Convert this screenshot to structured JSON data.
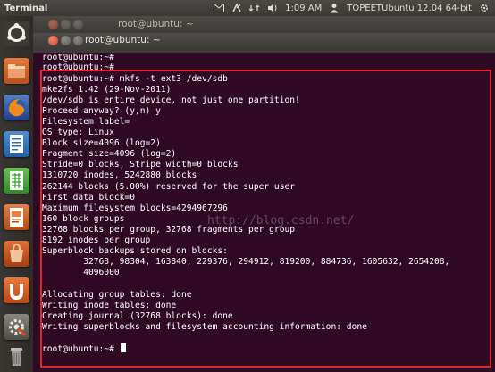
{
  "panel": {
    "app_name": "Terminal",
    "clock": "1:09 AM",
    "user": "TOPEETUbuntu 12.04 64-bit",
    "tray_icons": [
      "mail-icon",
      "keyboard-icon",
      "network-icon",
      "volume-icon",
      "user-icon"
    ]
  },
  "launcher": {
    "items": [
      {
        "name": "ubuntu-dash-icon",
        "color": "#e0560e"
      },
      {
        "name": "home-folder-icon",
        "color": "#d46a2a"
      },
      {
        "name": "firefox-icon",
        "color": "#e8821c"
      },
      {
        "name": "libreoffice-writer-icon",
        "color": "#2c6fb4"
      },
      {
        "name": "libreoffice-calc-icon",
        "color": "#3b9a2e"
      },
      {
        "name": "libreoffice-impress-icon",
        "color": "#c0521e"
      },
      {
        "name": "software-center-icon",
        "color": "#c24a1a"
      },
      {
        "name": "ubuntu-one-icon",
        "color": "#d2571d"
      },
      {
        "name": "system-settings-icon",
        "color": "#6a6660"
      },
      {
        "name": "trash-icon",
        "color": "#7c7a75"
      }
    ]
  },
  "background_window": {
    "title": "root@ubuntu: ~"
  },
  "terminal": {
    "title": "root@ubuntu: ~",
    "lines": [
      "root@ubuntu:~#",
      "root@ubuntu:~#",
      "root@ubuntu:~# mkfs -t ext3 /dev/sdb",
      "mke2fs 1.42 (29-Nov-2011)",
      "/dev/sdb is entire device, not just one partition!",
      "Proceed anyway? (y,n) y",
      "Filesystem label=",
      "OS type: Linux",
      "Block size=4096 (log=2)",
      "Fragment size=4096 (log=2)",
      "Stride=0 blocks, Stripe width=0 blocks",
      "1310720 inodes, 5242880 blocks",
      "262144 blocks (5.00%) reserved for the super user",
      "First data block=0",
      "Maximum filesystem blocks=4294967296",
      "160 block groups",
      "32768 blocks per group, 32768 fragments per group",
      "8192 inodes per group",
      "Superblock backups stored on blocks:",
      "        32768, 98304, 163840, 229376, 294912, 819200, 884736, 1605632, 2654208,",
      "        4096000",
      "",
      "Allocating group tables: done",
      "Writing inode tables: done",
      "Creating journal (32768 blocks): done",
      "Writing superblocks and filesystem accounting information: done",
      "",
      "root@ubuntu:~# "
    ],
    "watermark": "http://blog.csdn.net/"
  },
  "colors": {
    "terminal_bg": "#300a24",
    "highlight": "#e0282a"
  }
}
